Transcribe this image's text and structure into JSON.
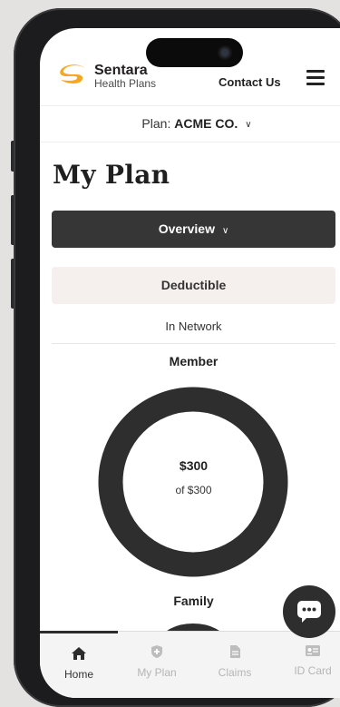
{
  "brand": {
    "name": "Sentara",
    "sub": "Health Plans",
    "accent": "#f5a81c"
  },
  "header": {
    "contact_label": "Contact Us"
  },
  "plan": {
    "prefix": "Plan:",
    "name": "ACME CO."
  },
  "page_title": "My Plan",
  "overview": {
    "label": "Overview"
  },
  "section": {
    "label": "Deductible",
    "network": "In Network"
  },
  "member": {
    "label": "Member",
    "amount": "$300",
    "of": "of $300",
    "progress": 1.0
  },
  "family": {
    "label": "Family"
  },
  "nav": {
    "items": [
      {
        "label": "Home",
        "icon": "home-icon",
        "active": true
      },
      {
        "label": "My Plan",
        "icon": "shield-icon",
        "active": false
      },
      {
        "label": "Claims",
        "icon": "document-icon",
        "active": false
      },
      {
        "label": "ID Card",
        "icon": "id-card-icon",
        "active": false
      }
    ]
  },
  "colors": {
    "dark": "#363636",
    "highlight": "#f5f0ed"
  }
}
